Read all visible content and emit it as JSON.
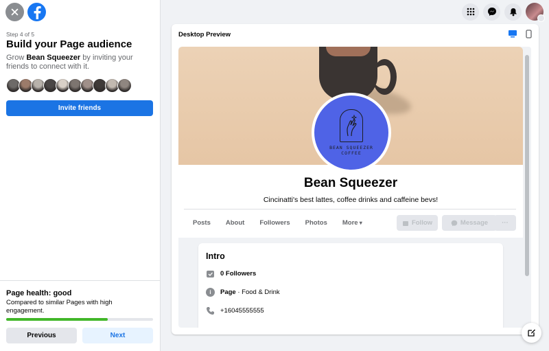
{
  "sidebar": {
    "step": "Step 4 of 5",
    "heading": "Build your Page audience",
    "desc_prefix": "Grow ",
    "desc_name": "Bean Squeezer",
    "desc_suffix": " by inviting your friends to connect with it.",
    "invite_label": "Invite friends",
    "friend_avatar_colors": [
      "#6d6a68",
      "#9c7b6a",
      "#b8b2ab",
      "#4b4746",
      "#d9d0c7",
      "#7d7570",
      "#a0908a",
      "#3f3a38",
      "#c2b9b0",
      "#8f8680"
    ]
  },
  "health": {
    "title": "Page health: good",
    "desc": "Compared to similar Pages with high engagement.",
    "progress": 0.69,
    "previous_label": "Previous",
    "next_label": "Next"
  },
  "preview": {
    "title": "Desktop Preview",
    "page_name": "Bean Squeezer",
    "logo_line1": "BEAN SQUEEZER",
    "logo_line2": "COFFEE",
    "bio": "Cincinatti's best lattes, coffee drinks and caffeine bevs!",
    "tabs": [
      "Posts",
      "About",
      "Followers",
      "Photos",
      "More"
    ],
    "follow_label": "Follow",
    "message_label": "Message",
    "more_label": "···",
    "intro_title": "Intro",
    "followers": "0 Followers",
    "page_label": "Page",
    "page_category": " · Food & Drink",
    "phone": "+16045555555"
  },
  "colors": {
    "accent": "#1b74e4",
    "profile_bg": "#4f63e6",
    "health_bar": "#42b72a"
  }
}
